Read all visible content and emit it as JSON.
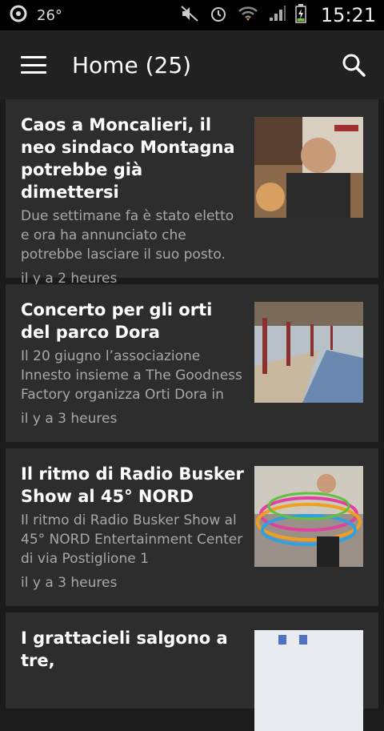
{
  "status": {
    "temperature": "26°",
    "time": "15:21"
  },
  "appbar": {
    "title": "Home (25)"
  },
  "articles": [
    {
      "title": "Caos a Moncalieri, il neo sindaco Montagna potrebbe già dimettersi",
      "description": "Due settimane fa è stato eletto e ora ha annunciato che potrebbe lasciare il suo posto.",
      "time": "il y a 2 heures"
    },
    {
      "title": "Concerto per gli orti del parco Dora",
      "description": "Il 20 giugno l’associazione Innesto insieme a The Goodness Factory organizza Orti Dora in",
      "time": "il y a 3 heures"
    },
    {
      "title": "Il ritmo di Radio Busker Show al 45° NORD",
      "description": "Il ritmo di Radio Busker Show al 45° NORD Entertainment Center di via Postiglione 1",
      "time": "il y a 3 heures"
    },
    {
      "title": "I grattacieli salgono a tre,",
      "description": "",
      "time": ""
    }
  ]
}
